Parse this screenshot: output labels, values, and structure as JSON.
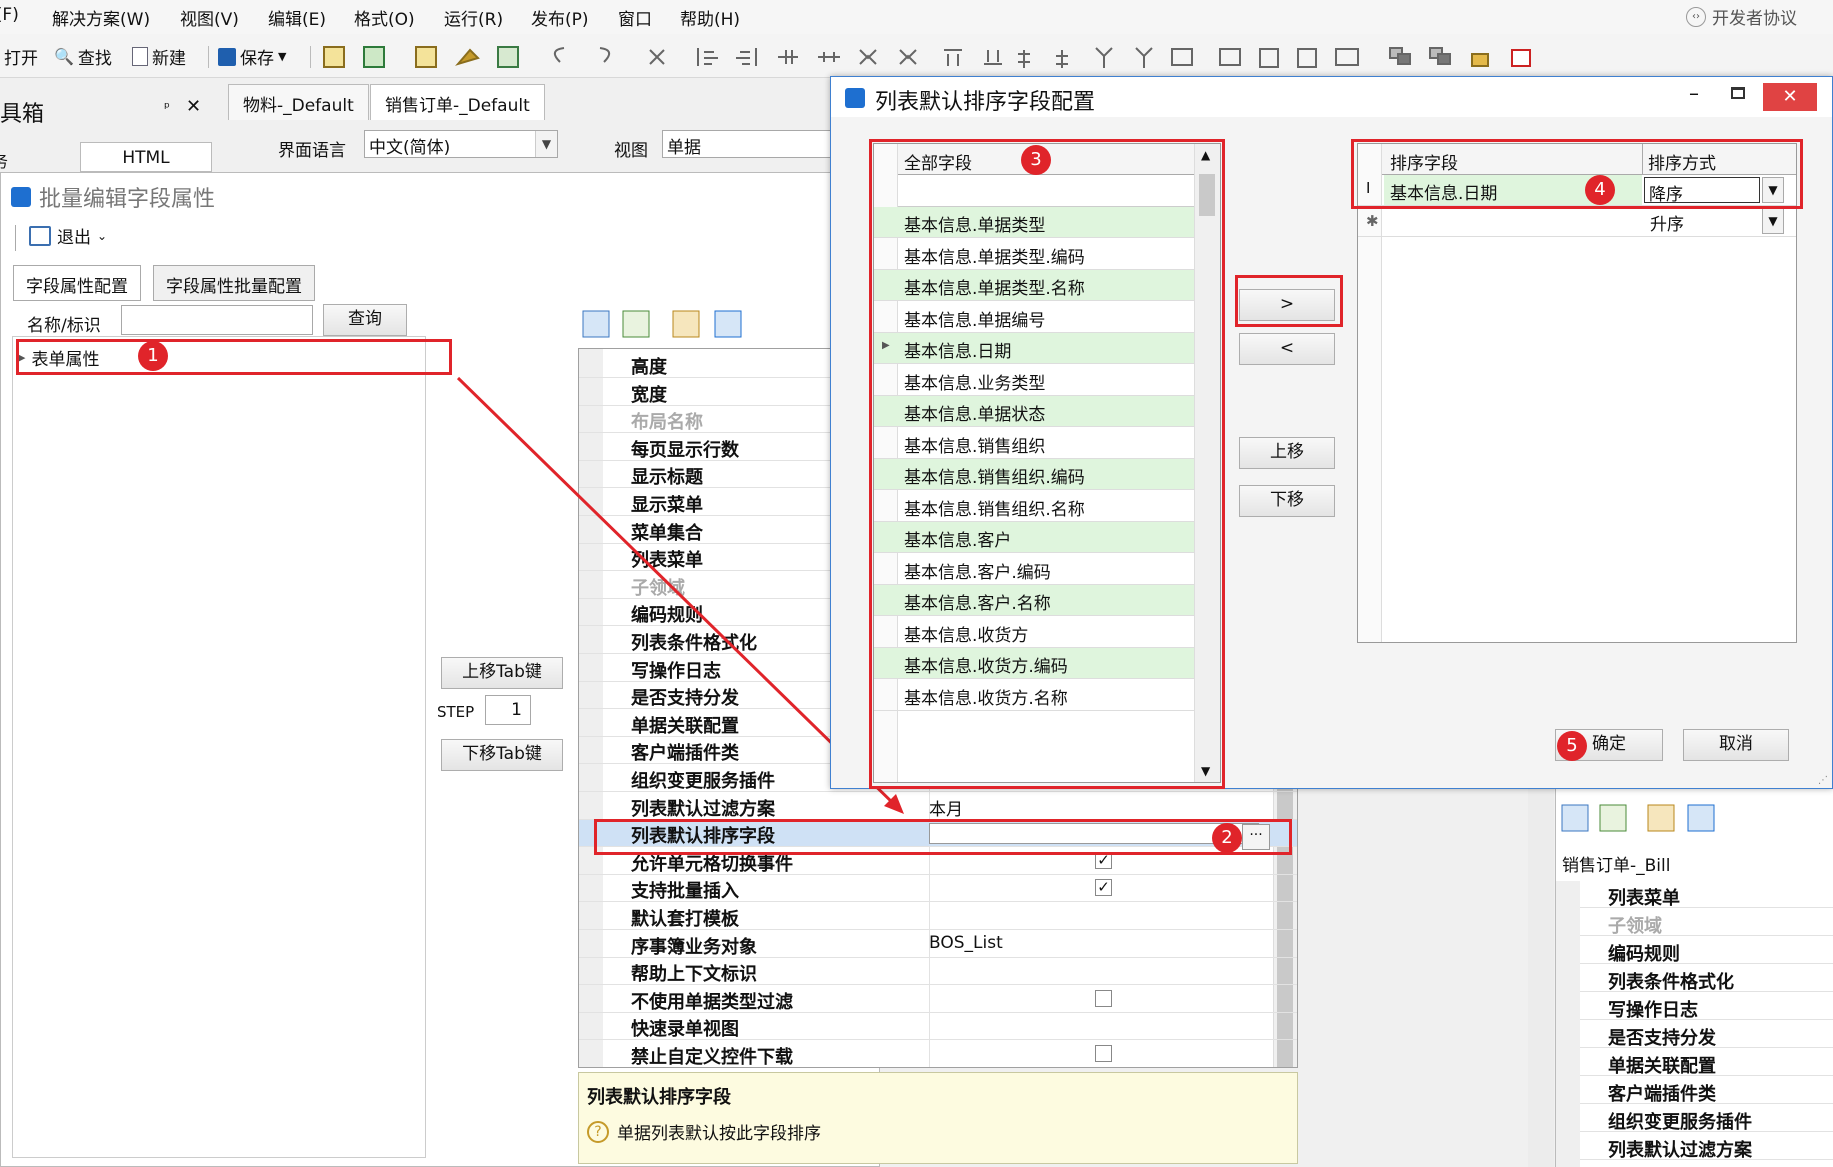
{
  "menu": [
    "F(F)",
    "解决方案(W)",
    "视图(V)",
    "编辑(E)",
    "格式(O)",
    "运行(R)",
    "发布(P)",
    "窗口",
    "帮助(H)"
  ],
  "dev_link": "开发者协议",
  "toolbar": {
    "open": "打开",
    "find": "查找",
    "new": "新建",
    "save": "保存"
  },
  "toolbox": {
    "title": "工具箱",
    "html_tab": "HTML",
    "side_letter": "务"
  },
  "doc_tabs": [
    "物料-_Default",
    "销售订单-_Default"
  ],
  "lang_label": "界面语言",
  "lang_value": "中文(简体)",
  "view_label": "视图",
  "view_value": "单据",
  "batch": {
    "title": "批量编辑字段属性",
    "exit": "退出",
    "tab1": "字段属性配置",
    "tab2": "字段属性批量配置",
    "name_label": "名称/标识",
    "query": "查询",
    "tree_item": "表单属性",
    "move_up_tab": "上移Tab键",
    "step_label": "STEP",
    "step_value": "1",
    "move_down_tab": "下移Tab键"
  },
  "props": [
    {
      "name": "高度",
      "val": ""
    },
    {
      "name": "宽度",
      "val": ""
    },
    {
      "name": "布局名称",
      "val": "",
      "dim": true
    },
    {
      "name": "每页显示行数",
      "val": ""
    },
    {
      "name": "显示标题",
      "val": ""
    },
    {
      "name": "显示菜单",
      "val": ""
    },
    {
      "name": "菜单集合",
      "val": ""
    },
    {
      "name": "列表菜单",
      "val": ""
    },
    {
      "name": "子领域",
      "val": "",
      "dim": true
    },
    {
      "name": "编码规则",
      "val": ""
    },
    {
      "name": "列表条件格式化",
      "val": ""
    },
    {
      "name": "写操作日志",
      "val": ""
    },
    {
      "name": "是否支持分发",
      "val": ""
    },
    {
      "name": "单据关联配置",
      "val": ""
    },
    {
      "name": "客户端插件类",
      "val": ""
    },
    {
      "name": "组织变更服务插件",
      "val": ""
    },
    {
      "name": "列表默认过滤方案",
      "val": "本月"
    },
    {
      "name": "列表默认排序字段",
      "val": ""
    },
    {
      "name": "允许单元格切换事件",
      "val": ""
    },
    {
      "name": "支持批量插入",
      "val": ""
    },
    {
      "name": "默认套打模板",
      "val": ""
    },
    {
      "name": "序事簿业务对象",
      "val": "BOS_List"
    },
    {
      "name": "帮助上下文标识",
      "val": ""
    },
    {
      "name": "不使用单据类型过滤",
      "val": ""
    },
    {
      "name": "快速录单视图",
      "val": ""
    },
    {
      "name": "禁止自定义控件下载",
      "val": ""
    }
  ],
  "help": {
    "title": "列表默认排序字段",
    "desc": "单据列表默认按此字段排序"
  },
  "dialog": {
    "title": "列表默认排序字段配置",
    "all_fields_header": "全部字段",
    "all_fields": [
      "基本信息.单据类型",
      "基本信息.单据类型.编码",
      "基本信息.单据类型.名称",
      "基本信息.单据编号",
      "基本信息.日期",
      "基本信息.业务类型",
      "基本信息.单据状态",
      "基本信息.销售组织",
      "基本信息.销售组织.编码",
      "基本信息.销售组织.名称",
      "基本信息.客户",
      "基本信息.客户.编码",
      "基本信息.客户.名称",
      "基本信息.收货方",
      "基本信息.收货方.编码",
      "基本信息.收货方.名称"
    ],
    "sort_field_header": "排序字段",
    "sort_order_header": "排序方式",
    "sort_row_field": "基本信息.日期",
    "sort_row_order": "降序",
    "sort_new_order": "升序",
    "add_btn": ">",
    "remove_btn": "<",
    "up_btn": "上移",
    "down_btn": "下移",
    "ok": "确定",
    "cancel": "取消"
  },
  "right_panel": {
    "title": "销售订单-_Bill",
    "props": [
      "列表菜单",
      "子领域",
      "编码规则",
      "列表条件格式化",
      "写操作日志",
      "是否支持分发",
      "单据关联配置",
      "客户端插件类",
      "组织变更服务插件",
      "列表默认过滤方案"
    ]
  },
  "badges": [
    "1",
    "2",
    "3",
    "4",
    "5"
  ]
}
